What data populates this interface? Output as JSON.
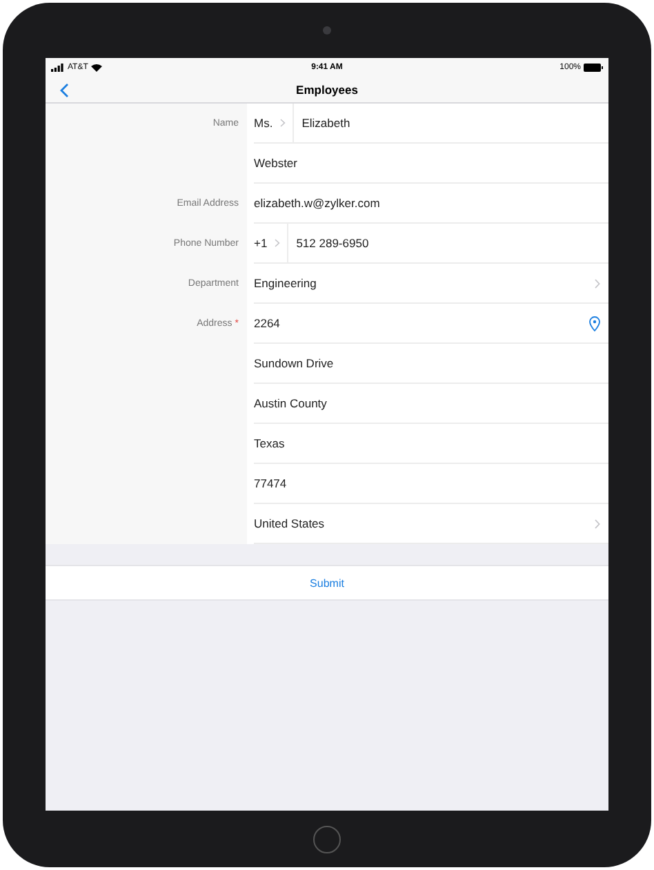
{
  "status_bar": {
    "carrier": "AT&T",
    "time": "9:41 AM",
    "battery": "100%"
  },
  "nav": {
    "title": "Employees"
  },
  "fields": [
    {
      "label": "Name",
      "rows": [
        {
          "kind": "split",
          "prefix": "Ms.",
          "value": "Elizabeth"
        },
        {
          "kind": "text",
          "value": "Webster"
        }
      ]
    },
    {
      "label": "Email Address",
      "rows": [
        {
          "kind": "text",
          "value": "elizabeth.w@zylker.com"
        }
      ]
    },
    {
      "label": "Phone Number",
      "rows": [
        {
          "kind": "split",
          "prefix": "+1",
          "value": "512 289-6950"
        }
      ]
    },
    {
      "label": "Department",
      "rows": [
        {
          "kind": "picker",
          "value": "Engineering"
        }
      ]
    },
    {
      "label": "Address",
      "required_mark": "*",
      "rows": [
        {
          "kind": "location",
          "value": "2264"
        },
        {
          "kind": "text",
          "value": "Sundown Drive"
        },
        {
          "kind": "text",
          "value": "Austin County"
        },
        {
          "kind": "text",
          "value": "Texas"
        },
        {
          "kind": "text",
          "value": "77474"
        },
        {
          "kind": "picker",
          "value": "United States"
        }
      ]
    }
  ],
  "submit": "Submit"
}
